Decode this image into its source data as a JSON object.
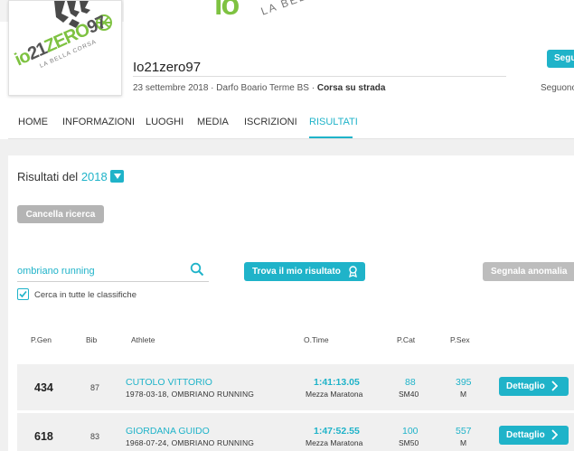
{
  "brand": {
    "hero_text": "io",
    "hero_subtext": "LA BELLA"
  },
  "logo": {
    "big": "io21ZERO97",
    "small": "LA BELLA CORSA"
  },
  "event": {
    "title": "Io21zero97",
    "date": "23 settembre 2018",
    "location": "Darfo Boario Terme BS",
    "type": "Corsa su strada",
    "separator": "·"
  },
  "follow": {
    "button": "Segu",
    "count_label": "Seguono"
  },
  "nav": {
    "items": [
      "HOME",
      "INFORMAZIONI",
      "LUOGHI",
      "MEDIA",
      "ISCRIZIONI",
      "RISULTATI"
    ],
    "active": "RISULTATI"
  },
  "results": {
    "title_prefix": "Risultati del",
    "year": "2018",
    "clear_button": "Cancella ricerca",
    "search_value": "ombriano running",
    "find_button": "Trova il mio risultato",
    "report_button": "Segnala anomalia",
    "checkbox_label": "Cerca in tutte le classifiche",
    "checkbox_checked": true
  },
  "table": {
    "headers": {
      "pgen": "P.Gen",
      "bib": "Bib",
      "athlete": "Athlete",
      "otime": "O.Time",
      "pcat": "P.Cat",
      "psex": "P.Sex"
    },
    "rows": [
      {
        "pgen": "434",
        "bib": "87",
        "name": "CUTOLO VITTORIO",
        "info": "1978-03-18, OMBRIANO RUNNING",
        "time": "1:41:13.05",
        "race": "Mezza Maratona",
        "pcat": "88",
        "cat": "SM40",
        "psex": "395",
        "sex": "M",
        "button": "Dettaglio"
      },
      {
        "pgen": "618",
        "bib": "83",
        "name": "GIORDANA GUIDO",
        "info": "1968-07-24, OMBRIANO RUNNING",
        "time": "1:47:52.55",
        "race": "Mezza Maratona",
        "pcat": "100",
        "cat": "SM50",
        "psex": "557",
        "sex": "M",
        "button": "Dettaglio"
      }
    ]
  },
  "colors": {
    "accent": "#1fb3c9",
    "brand_green": "#7ec241",
    "disabled": "#b4b4b4"
  },
  "icons": [
    "search-icon",
    "medal-icon",
    "chevron-right-icon",
    "check-icon",
    "dropdown-arrow-icon"
  ]
}
